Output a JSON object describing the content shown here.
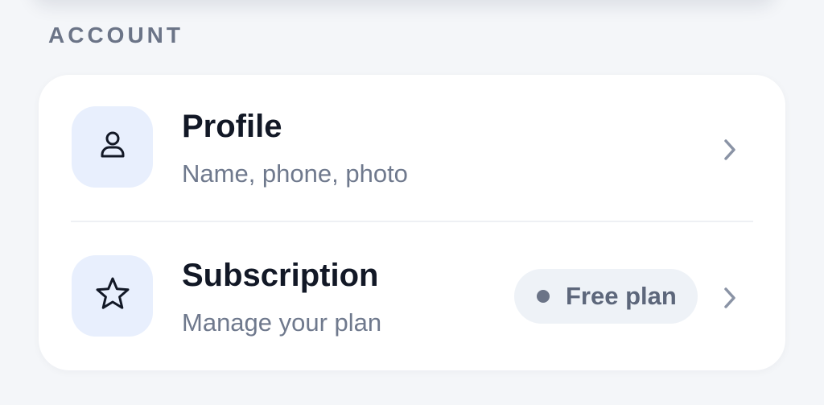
{
  "section": {
    "title": "ACCOUNT"
  },
  "rows": [
    {
      "title": "Profile",
      "subtitle": "Name, phone, photo",
      "icon": "person-icon"
    },
    {
      "title": "Subscription",
      "subtitle": "Manage your plan",
      "icon": "star-icon",
      "badge": {
        "label": "Free plan",
        "dot_color": "#6b7487"
      }
    }
  ],
  "colors": {
    "background": "#f4f6f9",
    "card": "#ffffff",
    "icon_tile": "#e8effd",
    "title_text": "#121826",
    "subtitle_text": "#6f798d",
    "section_title": "#6b7487",
    "badge_bg": "#eef2f7",
    "chevron": "#8a93a5"
  }
}
